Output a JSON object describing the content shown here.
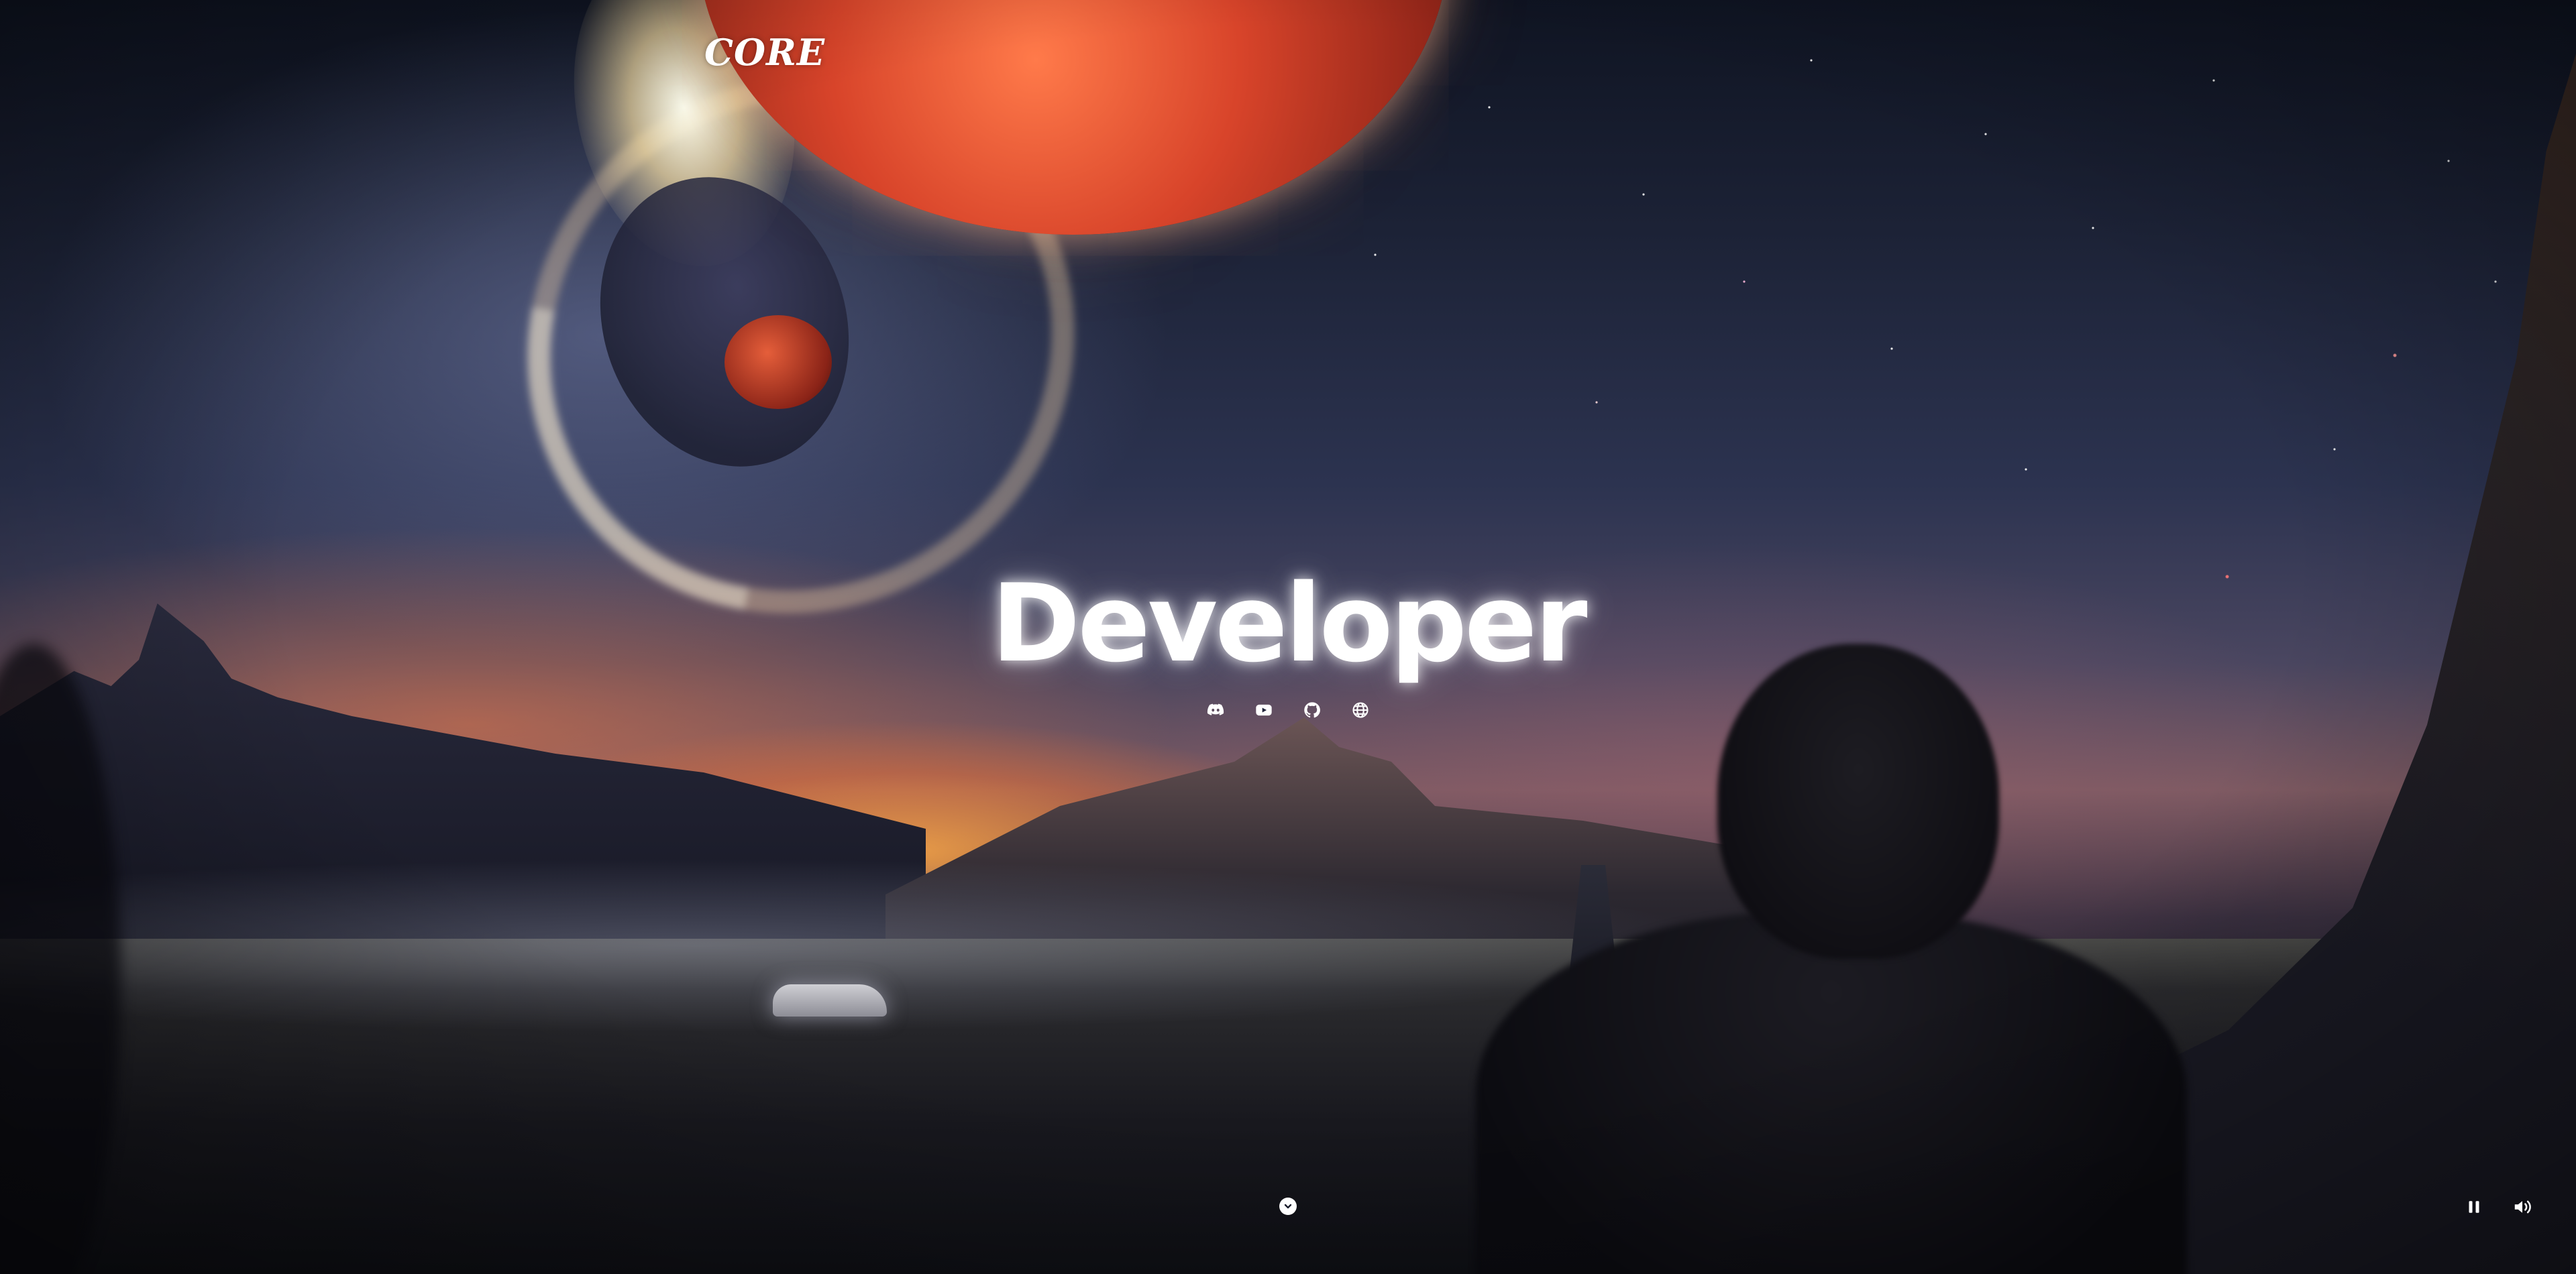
{
  "header": {
    "logo_text": "CORE"
  },
  "hero": {
    "title": "Developer",
    "socials": [
      {
        "name": "discord-icon"
      },
      {
        "name": "youtube-icon"
      },
      {
        "name": "github-icon"
      },
      {
        "name": "globe-icon"
      }
    ]
  },
  "controls": {
    "scroll_icon": "chevron-down-icon",
    "pause_icon": "pause-icon",
    "volume_icon": "volume-icon"
  },
  "colors": {
    "text": "#ffffff",
    "planet": "#d8442a",
    "sky_dark": "#1c2236",
    "sunset": "#ffaa46"
  }
}
